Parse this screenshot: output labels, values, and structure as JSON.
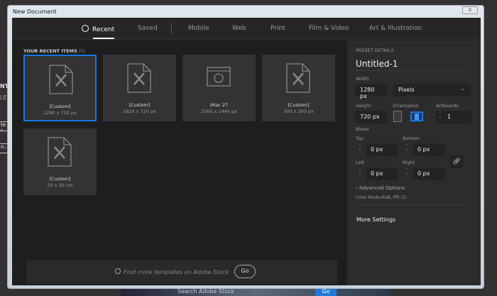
{
  "background": {
    "fragments": [
      "NT",
      "LES",
      "te r",
      "n..."
    ],
    "search_placeholder": "Search Adobe Stock",
    "go_label": "Go"
  },
  "window": {
    "title": "New Document",
    "close": "X"
  },
  "tabs": [
    {
      "label": "Recent",
      "active": true
    },
    {
      "label": "Saved"
    },
    {
      "label": "Mobile"
    },
    {
      "label": "Web"
    },
    {
      "label": "Print"
    },
    {
      "label": "Film & Video"
    },
    {
      "label": "Art & Illustration"
    }
  ],
  "recent": {
    "heading": "YOUR RECENT ITEMS",
    "count": "(5)",
    "items": [
      {
        "name": "[Custom]",
        "size": "1280 x 720 px",
        "icon": "document-icon",
        "selected": true
      },
      {
        "name": "[Custom]",
        "size": "1820 x 720 px",
        "icon": "document-icon"
      },
      {
        "name": "iMac 27",
        "size": "2560 x 1440 px",
        "icon": "web-icon"
      },
      {
        "name": "[Custom]",
        "size": "300 x 300 px",
        "icon": "document-icon"
      },
      {
        "name": "[Custom]",
        "size": "20 x 20 cm",
        "icon": "document-icon"
      }
    ]
  },
  "stock": {
    "placeholder": "Find more templates on Adobe Stock",
    "go_label": "Go"
  },
  "preset": {
    "heading": "PRESET DETAILS",
    "name": "Untitled-1",
    "width_label": "Width",
    "width": "1280 px",
    "units": "Pixels",
    "height_label": "Height",
    "height": "720 px",
    "orientation_label": "Orientation",
    "orientation": "landscape",
    "artboards_label": "Artboards",
    "artboards": "1",
    "bleed_label": "Bleed",
    "top_label": "Top",
    "top": "0 px",
    "bottom_label": "Bottom",
    "bottom": "0 px",
    "left_label": "Left",
    "left": "0 px",
    "right_label": "Right",
    "right": "0 px",
    "advanced": "Advanced Options",
    "color_mode": "Color Mode:RGB, PPI:72",
    "more_settings": "More Settings"
  },
  "colors": {
    "accent": "#1a73e8"
  }
}
